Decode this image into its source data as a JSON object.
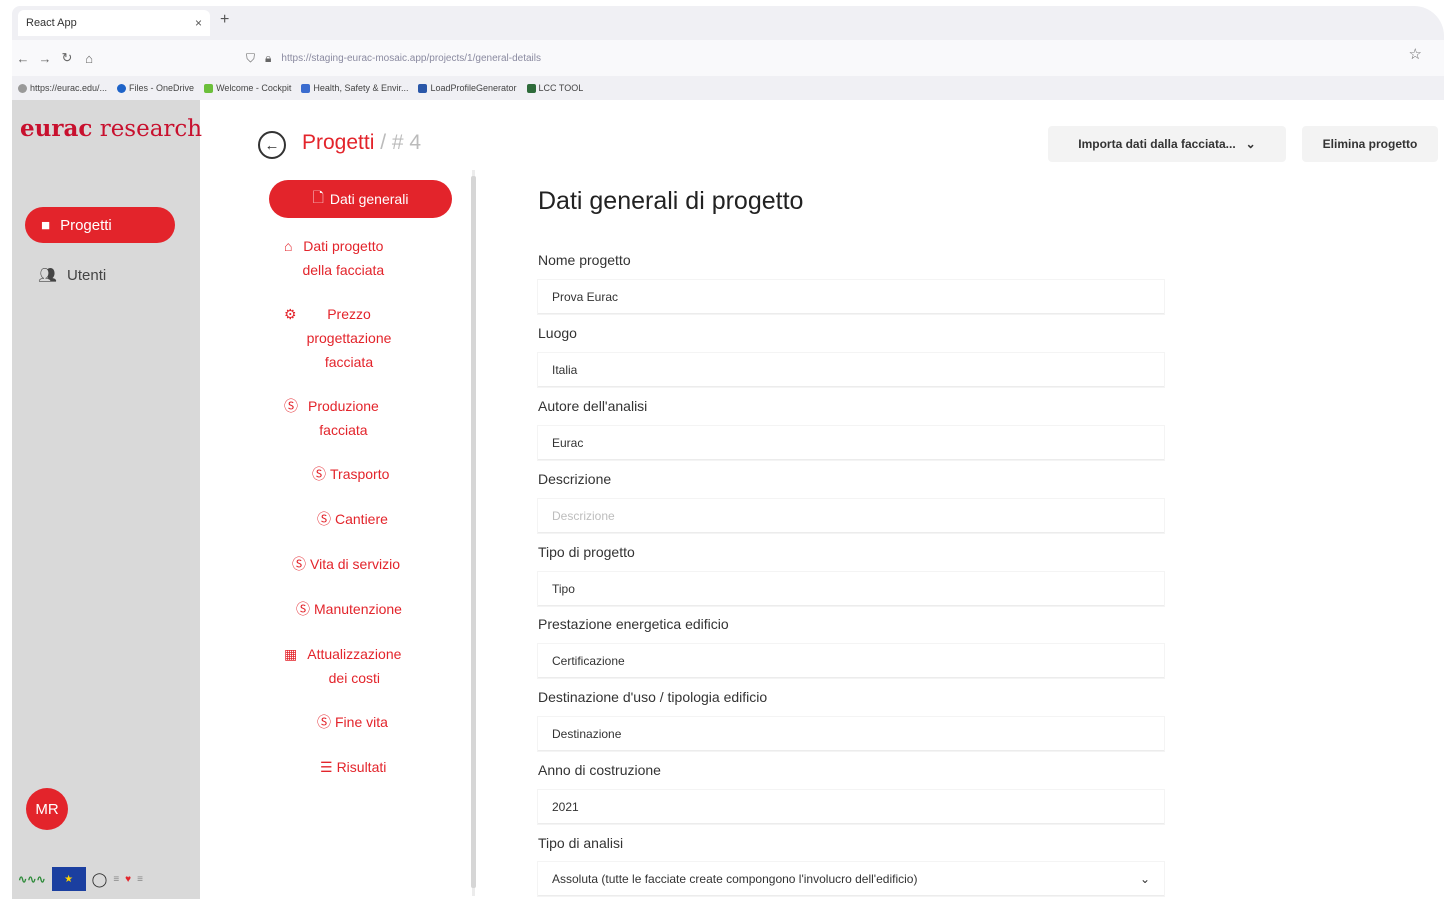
{
  "browser": {
    "tab_title": "React App",
    "tab_close": "×",
    "new_tab": "+",
    "url": "https://staging-eurac-mosaic.app/projects/1/general-details",
    "bookmarks": [
      "https://eurac.edu/...",
      "Files - OneDrive",
      "Welcome - Cockpit",
      "Health, Safety & Envir...",
      "LoadProfileGenerator",
      "LCC TOOL"
    ]
  },
  "sidebar": {
    "logo_bold": "eurac",
    "logo_regular": " research",
    "items": [
      {
        "label": "Progetti"
      },
      {
        "label": "Utenti"
      }
    ],
    "avatar_initials": "MR",
    "eu_label": "★"
  },
  "header": {
    "breadcrumb_root": "Progetti",
    "breadcrumb_sep": " / ",
    "breadcrumb_current": "# 4",
    "import_label": "Importa dati dalla facciata...",
    "delete_label": "Elimina progetto"
  },
  "steps": [
    {
      "label": "Dati generali"
    },
    {
      "label_line1": "Dati progetto",
      "label_line2": "della facciata"
    },
    {
      "label_line1": "Prezzo",
      "label_line2": "progettazione",
      "label_line3": "facciata"
    },
    {
      "label_line1": "Produzione",
      "label_line2": "facciata"
    },
    {
      "label": "Trasporto"
    },
    {
      "label": "Cantiere"
    },
    {
      "label": "Vita di servizio"
    },
    {
      "label": "Manutenzione"
    },
    {
      "label_line1": "Attualizzazione",
      "label_line2": "dei costi"
    },
    {
      "label": "Fine vita"
    },
    {
      "label": "Risultati"
    }
  ],
  "form": {
    "title": "Dati generali di progetto",
    "fields": [
      {
        "label": "Nome progetto",
        "value": "Prova Eurac",
        "placeholder": ""
      },
      {
        "label": "Luogo",
        "value": "Italia",
        "placeholder": ""
      },
      {
        "label": "Autore dell'analisi",
        "value": "Eurac",
        "placeholder": ""
      },
      {
        "label": "Descrizione",
        "value": "",
        "placeholder": "Descrizione"
      },
      {
        "label": "Tipo di progetto",
        "value": "Tipo",
        "placeholder": ""
      },
      {
        "label": "Prestazione energetica edificio",
        "value": "Certificazione",
        "placeholder": ""
      },
      {
        "label": "Destinazione d'uso / tipologia edificio",
        "value": "Destinazione",
        "placeholder": ""
      },
      {
        "label": "Anno di costruzione",
        "value": "2021",
        "placeholder": ""
      },
      {
        "label": "Tipo di analisi",
        "value": "Assoluta (tutte le facciate create compongono l'involucro dell'edificio)",
        "placeholder": ""
      }
    ]
  },
  "colors": {
    "accent": "#e3242b",
    "sidebar_bg": "#d9d9d9"
  }
}
